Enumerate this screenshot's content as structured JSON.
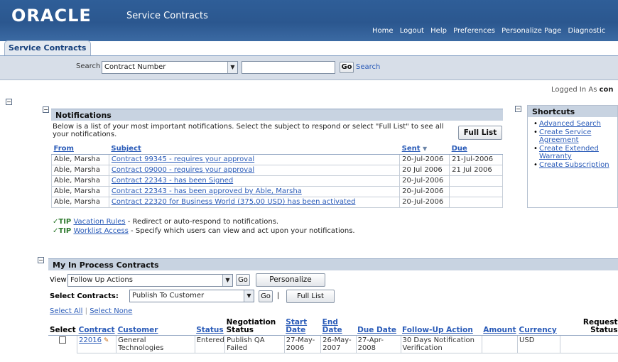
{
  "header": {
    "logo": "ORACLE",
    "app_title": "Service Contracts",
    "global_links": [
      "Home",
      "Logout",
      "Help",
      "Preferences",
      "Personalize Page",
      "Diagnostic"
    ]
  },
  "tab": {
    "label": "Service Contracts"
  },
  "search": {
    "label": "Search",
    "select_value": "Contract Number",
    "input_value": "",
    "go": "Go",
    "link": "Search"
  },
  "logged_in": {
    "prefix": "Logged In As",
    "user": "con"
  },
  "notifications": {
    "title": "Notifications",
    "description": "Below is a list of your most important notifications. Select the subject to respond or select \"Full List\" to see all your notifications.",
    "full_list": "Full List",
    "columns": {
      "from": "From",
      "subject": "Subject",
      "sent": "Sent",
      "due": "Due"
    },
    "rows": [
      {
        "from": "Able, Marsha",
        "subject": "Contract 99345 - requires your approval",
        "sent": "20-Jul-2006",
        "due": "21-Jul-2006"
      },
      {
        "from": "Able, Marsha",
        "subject": "Contract 09000 - requires your approval",
        "sent": "20 Jul 2006",
        "due": "21 Jul 2006"
      },
      {
        "from": "Able, Marsha",
        "subject": "Contract 22343 - has been Signed",
        "sent": "20-Jul-2006",
        "due": ""
      },
      {
        "from": "Able, Marsha",
        "subject": "Contract 22343 - has been approved by Able, Marsha",
        "sent": "20-Jul-2006",
        "due": ""
      },
      {
        "from": "Able, Marsha",
        "subject": "Contract 22320 for Business World (375.00 USD) has been activated",
        "sent": "20-Jul-2006",
        "due": ""
      }
    ],
    "tips": [
      {
        "label": "TIP",
        "link": "Vacation Rules",
        "text": " - Redirect or auto-respond to notifications."
      },
      {
        "label": "TIP",
        "link": "Worklist Access",
        "text": " - Specify which users can view and act upon your notifications."
      }
    ]
  },
  "shortcuts": {
    "title": "Shortcuts",
    "items": [
      "Advanced Search",
      "Create Service Agreement",
      "Create Extended Warranty",
      "Create Subscription"
    ]
  },
  "contracts": {
    "title": "My In Process Contracts",
    "view_label": "View",
    "view_value": "Follow Up Actions",
    "go": "Go",
    "personalize": "Personalize",
    "select_label": "Select Contracts:",
    "select_value": "Publish To Customer",
    "go2": "Go",
    "sep": "|",
    "full_list": "Full List",
    "select_all": "Select All",
    "select_none": "Select None",
    "columns": {
      "select": "Select",
      "contract": "Contract",
      "customer": "Customer",
      "status": "Status",
      "negotiation": "Negotiation Status",
      "start": "Start Date",
      "end": "End Date",
      "due": "Due Date",
      "followup": "Follow-Up Action",
      "amount": "Amount",
      "currency": "Currency",
      "request": "Request Status"
    },
    "rows": [
      {
        "contract": "22016",
        "customer": "General Technologies",
        "status": "Entered",
        "negotiation": "Publish QA Failed",
        "start": "27-May-2006",
        "end": "26-May-2007",
        "due": "27-Apr-2008",
        "followup": "30 Days Notification Verification",
        "amount": "",
        "currency": "USD",
        "request": ""
      }
    ]
  }
}
